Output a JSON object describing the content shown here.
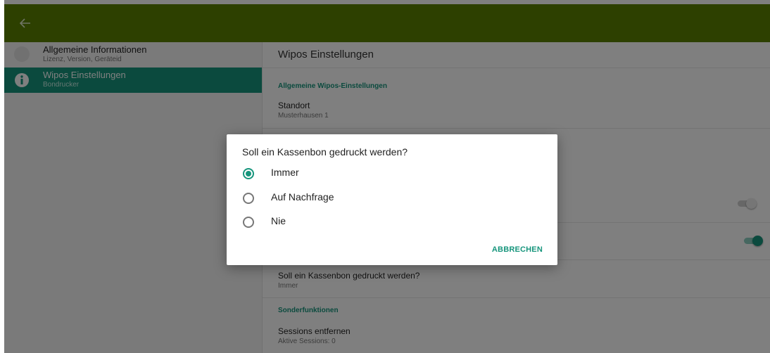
{
  "appbar": {
    "back_icon": "arrow-left-icon",
    "color": "#5a8100"
  },
  "sidebar": {
    "items": [
      {
        "title": "Allgemeine Informationen",
        "subtitle": "Lizenz, Version, Geräteid",
        "icon": "info-circle-icon",
        "active": false
      },
      {
        "title": "Wipos Einstellungen",
        "subtitle": "Bondrucker",
        "icon": "info-circle-icon",
        "active": true
      }
    ]
  },
  "content": {
    "title": "Wipos Einstellungen",
    "section1": "Allgemeine Wipos-Einstellungen",
    "standort_title": "Standort",
    "standort_value": "Musterhausen 1",
    "kassenbon_title": "Soll ein Kassenbon gedruckt werden?",
    "kassenbon_value": "Immer",
    "section2": "Sonderfunktionen",
    "sessions_title": "Sessions entfernen",
    "sessions_value": "Aktive Sessions: 0",
    "toggle1_on": false,
    "toggle2_on": true
  },
  "dialog": {
    "title": "Soll ein Kassenbon gedruckt werden?",
    "options": [
      "Immer",
      "Auf Nachfrage",
      "Nie"
    ],
    "selected": "Immer",
    "cancel": "ABBRECHEN"
  },
  "colors": {
    "accent": "#16957c",
    "appbar": "#5a8100"
  }
}
